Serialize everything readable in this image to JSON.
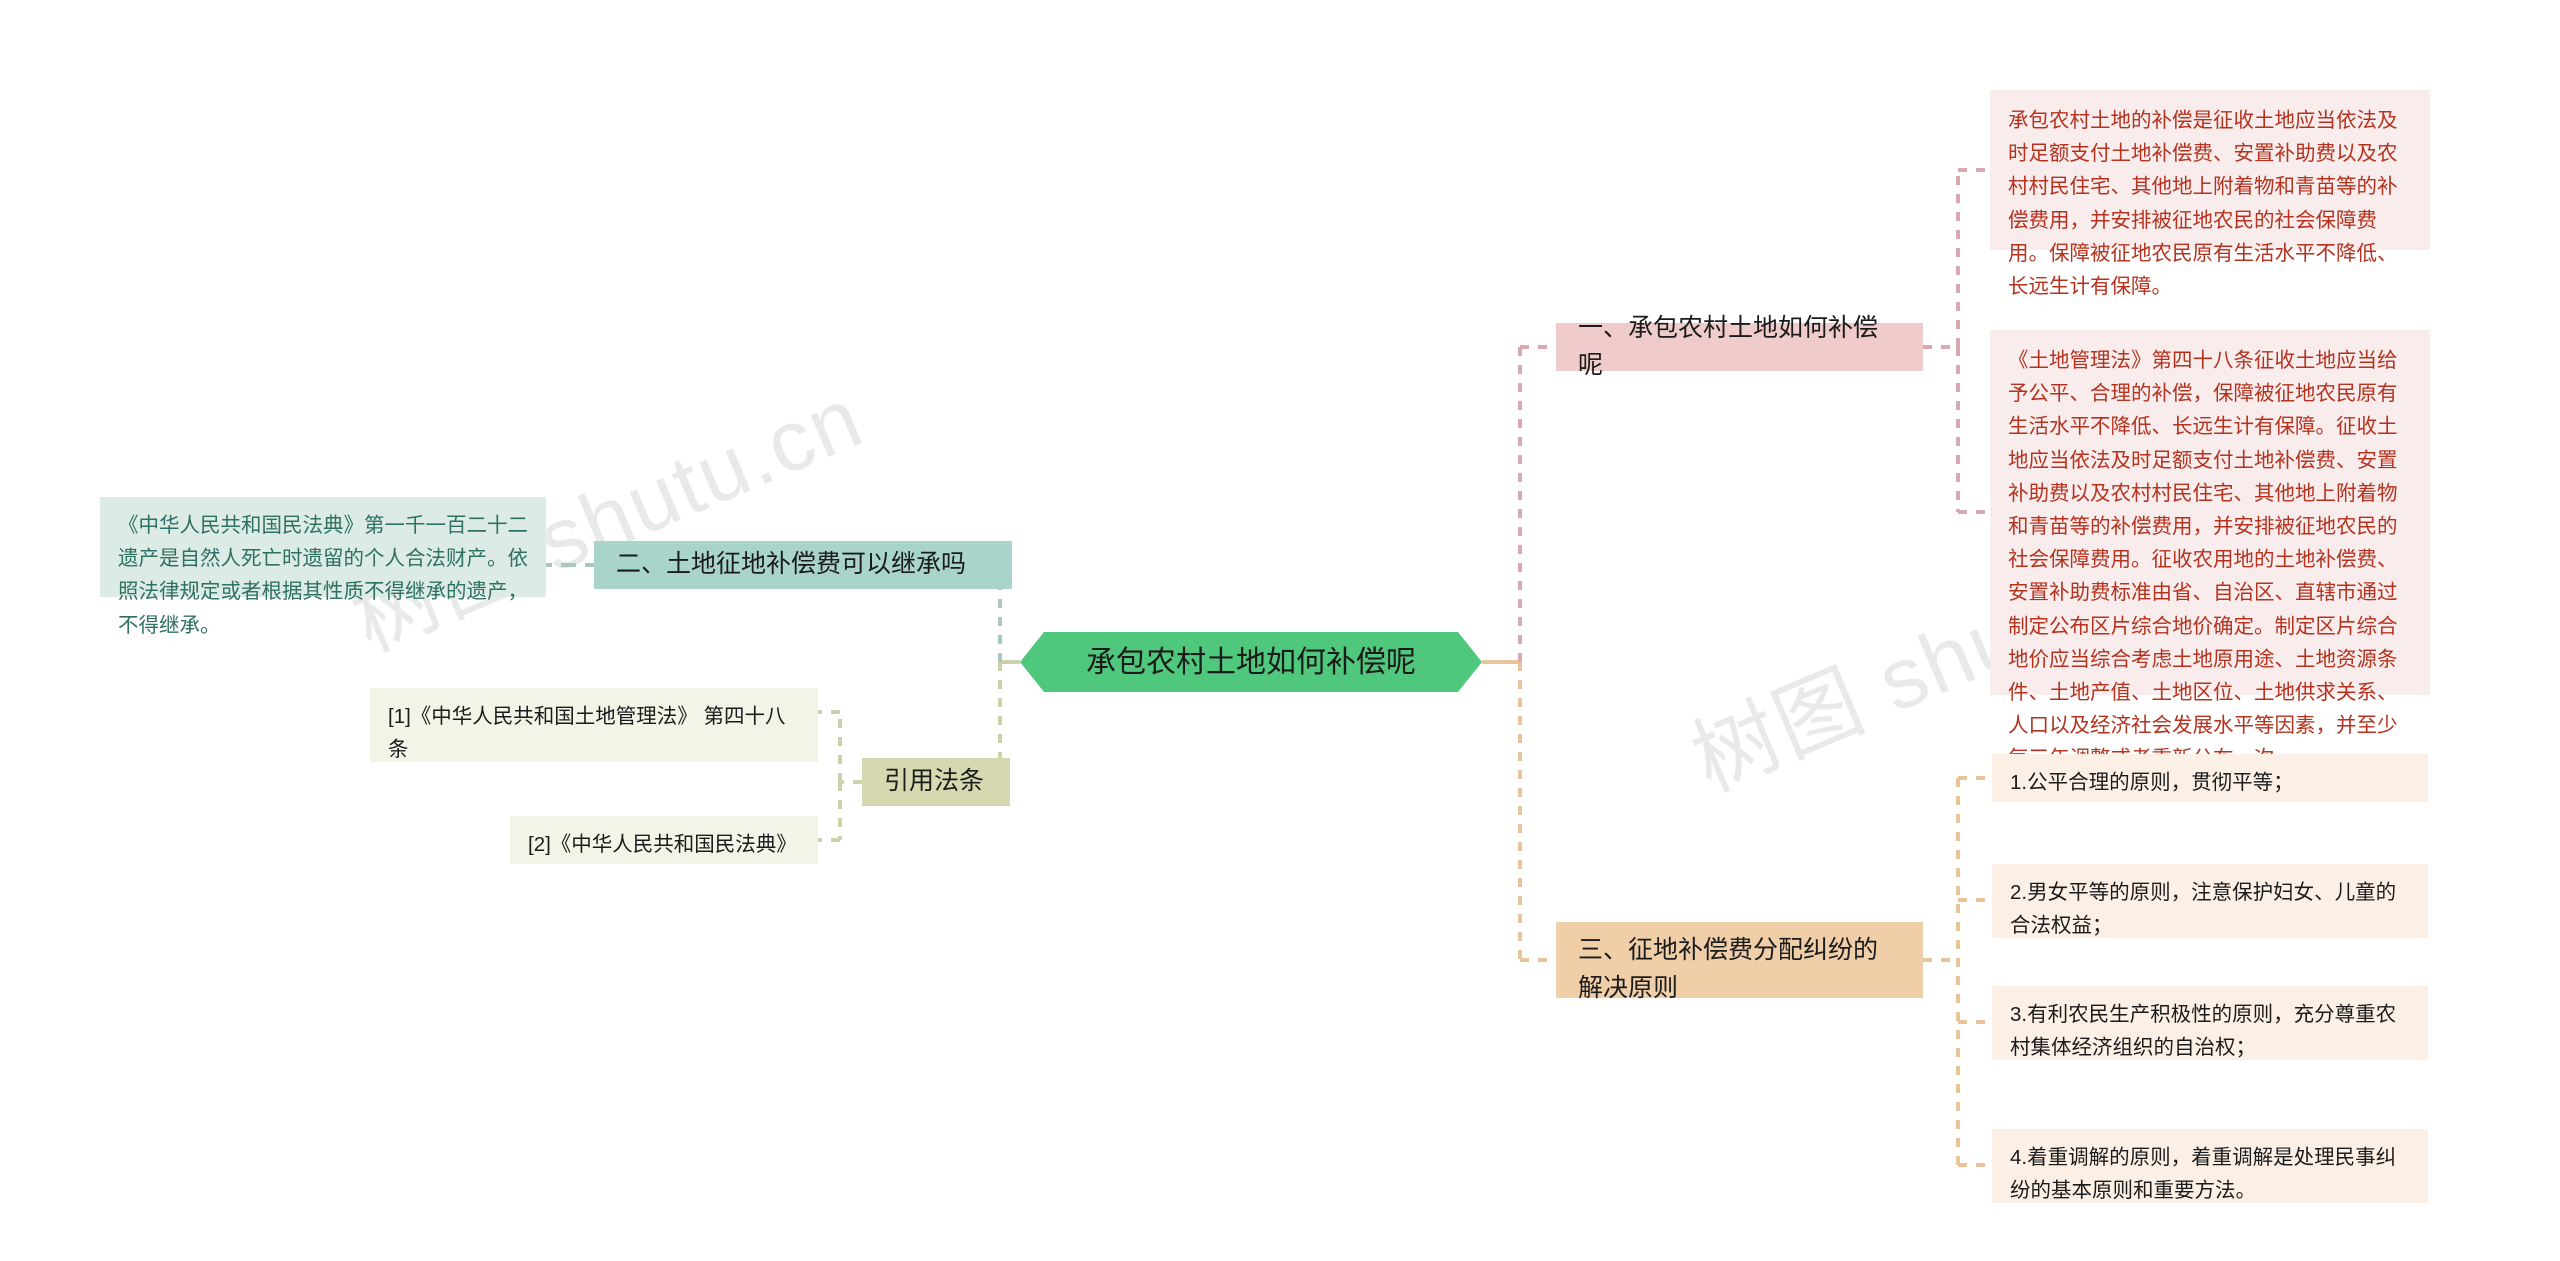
{
  "watermark": {
    "text": "树图 shutu.cn"
  },
  "colors": {
    "central": "#4FC87D",
    "branch_pink": "#EFCBCB",
    "branch_teal": "#A9D4CB",
    "branch_orange": "#F0CFA8",
    "branch_olive": "#D6D9B0",
    "leaf_red_bg": "#F8EDEC",
    "leaf_red_text": "#B5321F",
    "leaf_teal_bg": "#DCEBE6",
    "leaf_teal_text": "#2E7163",
    "leaf_peach_bg": "#FCF0E6",
    "leaf_ivory_bg": "#F3F3E7",
    "wire_pink": "#D9A9B0",
    "wire_orange": "#E9C39A",
    "wire_teal": "#A9C9C0",
    "wire_olive": "#CDD0A8"
  },
  "central": {
    "label": "承包农村土地如何补偿呢"
  },
  "branches": {
    "one": {
      "label": "一、承包农村土地如何补偿呢",
      "leaves": [
        {
          "label": "承包农村土地的补偿是征收土地应当依法及时足额支付土地补偿费、安置补助费以及农村村民住宅、其他地上附着物和青苗等的补偿费用，并安排被征地农民的社会保障费用。保障被征地农民原有生活水平不降低、长远生计有保障。"
        },
        {
          "label": "《土地管理法》第四十八条征收土地应当给予公平、合理的补偿，保障被征地农民原有生活水平不降低、长远生计有保障。征收土地应当依法及时足额支付土地补偿费、安置补助费以及农村村民住宅、其他地上附着物和青苗等的补偿费用，并安排被征地农民的社会保障费用。征收农用地的土地补偿费、安置补助费标准由省、自治区、直辖市通过制定公布区片综合地价确定。制定区片综合地价应当综合考虑土地原用途、土地资源条件、土地产值、土地区位、土地供求关系、人口以及经济社会发展水平等因素，并至少每三年调整或者重新公布一次。"
        }
      ]
    },
    "two": {
      "label": "二、土地征地补偿费可以继承吗",
      "leaves": [
        {
          "label": "《中华人民共和国民法典》第一千一百二十二遗产是自然人死亡时遗留的个人合法财产。依照法律规定或者根据其性质不得继承的遗产，不得继承。"
        }
      ]
    },
    "three": {
      "label": "三、征地补偿费分配纠纷的解决原则",
      "leaves": [
        {
          "label": "1.公平合理的原则，贯彻平等；"
        },
        {
          "label": "2.男女平等的原则，注意保护妇女、儿童的合法权益；"
        },
        {
          "label": "3.有利农民生产积极性的原则，充分尊重农村集体经济组织的自治权；"
        },
        {
          "label": "4.着重调解的原则，着重调解是处理民事纠纷的基本原则和重要方法。"
        }
      ]
    },
    "citations": {
      "label": "引用法条",
      "leaves": [
        {
          "label": "[1]《中华人民共和国土地管理法》 第四十八条"
        },
        {
          "label": "[2]《中华人民共和国民法典》"
        }
      ]
    }
  }
}
